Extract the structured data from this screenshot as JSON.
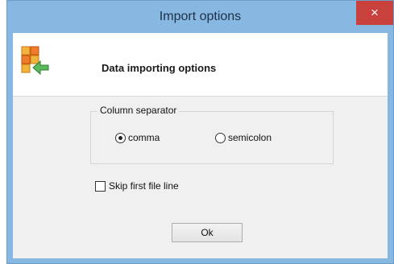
{
  "window": {
    "title": "Import options",
    "close_glyph": "×",
    "icon": "import-table-icon"
  },
  "header": {
    "title": "Data importing options"
  },
  "separator_group": {
    "label": "Column separator",
    "options": [
      {
        "label": "comma",
        "selected": true
      },
      {
        "label": "semicolon",
        "selected": false
      }
    ]
  },
  "skip_first_line": {
    "label": "Skip first file line",
    "checked": false
  },
  "ok_button": {
    "label": "Ok"
  },
  "colors": {
    "titlebar": "#87b8e2",
    "close_button": "#c9413d",
    "content_bg": "#f0f0f0"
  }
}
